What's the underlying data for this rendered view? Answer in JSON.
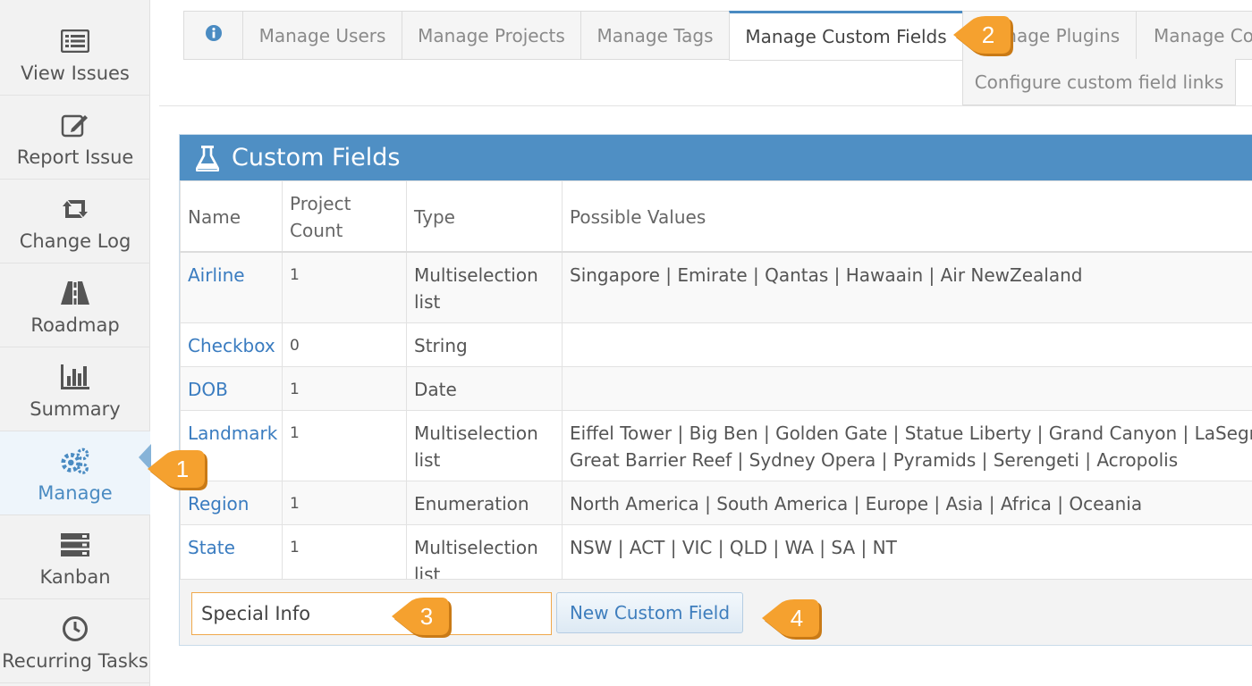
{
  "sidebar": {
    "items": [
      {
        "label": "View Issues",
        "icon": "list-icon"
      },
      {
        "label": "Report Issue",
        "icon": "edit-icon"
      },
      {
        "label": "Change Log",
        "icon": "retweet-icon"
      },
      {
        "label": "Roadmap",
        "icon": "road-icon"
      },
      {
        "label": "Summary",
        "icon": "bar-chart-icon"
      },
      {
        "label": "Manage",
        "icon": "gears-icon"
      },
      {
        "label": "Kanban",
        "icon": "server-icon"
      },
      {
        "label": "Recurring Tasks",
        "icon": "clock-icon"
      }
    ],
    "active_index": 5
  },
  "tabs": {
    "items": [
      "Manage Users",
      "Manage Projects",
      "Manage Tags",
      "Manage Custom Fields",
      "Manage Plugins",
      "Manage Co"
    ],
    "active": "Manage Custom Fields",
    "sub_tab": "Configure custom field links"
  },
  "widget": {
    "title": "Custom Fields",
    "columns": {
      "name": "Name",
      "count_line1": "Project",
      "count_line2": "Count",
      "type": "Type",
      "values": "Possible Values"
    },
    "rows": [
      {
        "name": "Airline",
        "count": "1",
        "type": "Multiselection list",
        "values": [
          "Singapore | Emirate | Qantas | Hawaain | Air NewZealand"
        ]
      },
      {
        "name": "Checkbox",
        "count": "0",
        "type": "String",
        "values": [
          ""
        ]
      },
      {
        "name": "DOB",
        "count": "1",
        "type": "Date",
        "values": [
          ""
        ]
      },
      {
        "name": "Landmark",
        "count": "1",
        "type": "Multiselection list",
        "values": [
          "Eiffel Tower | Big Ben | Golden Gate | Statue Liberty | Grand Canyon | LaSegrada",
          "Great Barrier Reef | Sydney Opera | Pyramids | Serengeti | Acropolis"
        ]
      },
      {
        "name": "Region",
        "count": "1",
        "type": "Enumeration",
        "values": [
          "North America | South America | Europe | Asia | Africa | Oceania"
        ]
      },
      {
        "name": "State",
        "count": "1",
        "type": "Multiselection list",
        "values": [
          "NSW | ACT | VIC | QLD | WA | SA | NT"
        ]
      }
    ],
    "new_field_input_value": "Special Info",
    "new_field_button": "New Custom Field"
  },
  "callouts": [
    "1",
    "2",
    "3",
    "4"
  ],
  "colors": {
    "accent": "#4f8fc4",
    "link": "#3a7cc0",
    "callout": "#f5a12f"
  }
}
